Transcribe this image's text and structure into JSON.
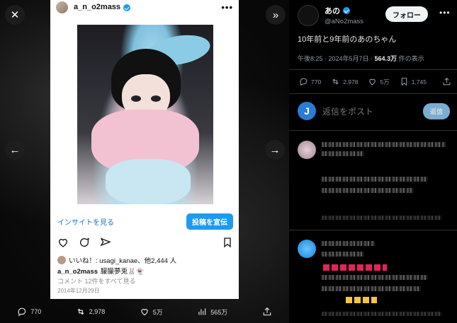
{
  "viewer": {
    "stats": [
      {
        "icon": "reply-icon",
        "value": "770"
      },
      {
        "icon": "retweet-icon",
        "value": "2,978"
      },
      {
        "icon": "like-icon",
        "value": "5万"
      },
      {
        "icon": "views-icon",
        "value": "565万"
      },
      {
        "icon": "share-icon",
        "value": ""
      }
    ]
  },
  "instagram": {
    "username": "a_n_o2mass",
    "insight_link": "インサイトを見る",
    "boost_button": "投稿を宣伝",
    "likes_text": "いいね！: usagi_kanae、他2,444 人",
    "caption_user": "a_n_o2mass",
    "caption_text": "朦朦夢兎🐰👻",
    "comments_link": "コメント 12件をすべて見る",
    "date": "2014年12月29日"
  },
  "tweet": {
    "display_name": "あの",
    "handle": "@aNo2mass",
    "follow_button": "フォロー",
    "text": "10年前と9年前のあのちゃん",
    "time": "午後8:25 · 2024年5月7日 · ",
    "views_count": "564.3万",
    "views_label": " 件の表示",
    "stats": {
      "replies": "770",
      "retweets": "2,978",
      "likes": "5万",
      "bookmarks": "1,745"
    },
    "reply_avatar_letter": "J",
    "reply_placeholder": "返信をポスト",
    "reply_button": "返信"
  }
}
